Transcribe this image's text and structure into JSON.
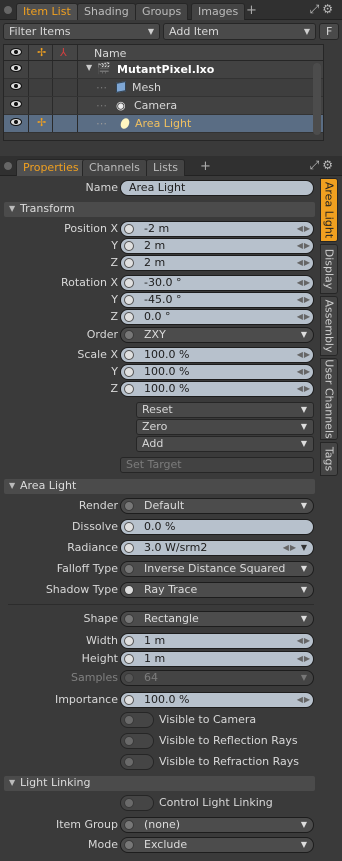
{
  "top_tabs": [
    {
      "label": "Item List",
      "active": true
    },
    {
      "label": "Shading",
      "active": false
    },
    {
      "label": "Groups",
      "active": false
    },
    {
      "label": "Images",
      "active": false
    }
  ],
  "tab_plus": "+",
  "filter_items": "Filter Items",
  "add_item": "Add Item",
  "f_button": "F",
  "tree": {
    "header_name": "Name",
    "rows": [
      {
        "label": "MutantPixel.lxo",
        "icon": "film-scene-icon"
      },
      {
        "label": "Mesh",
        "icon": "mesh-cube-icon"
      },
      {
        "label": "Camera",
        "icon": "camera-icon"
      },
      {
        "label": "Area Light",
        "icon": "area-light-icon",
        "selected": true
      }
    ]
  },
  "bottom_tabs": [
    {
      "label": "Properties",
      "active": true
    },
    {
      "label": "Channels",
      "active": false
    },
    {
      "label": "Lists",
      "active": false
    }
  ],
  "side_tabs": [
    "Area Light",
    "Display",
    "Assembly",
    "User Channels",
    "Tags"
  ],
  "name_label": "Name",
  "name_value": "Area Light",
  "transform": {
    "title": "Transform",
    "position_label": "Position X",
    "position": [
      "-2 m",
      "2 m",
      "2 m"
    ],
    "rotation_label": "Rotation X",
    "rotation": [
      "-30.0 °",
      "-45.0 °",
      "0.0 °"
    ],
    "order_label": "Order",
    "order": "ZXY",
    "scale_label": "Scale X",
    "scale": [
      "100.0 %",
      "100.0 %",
      "100.0 %"
    ],
    "y_label": "Y",
    "z_label": "Z",
    "reset": "Reset",
    "zero": "Zero",
    "add": "Add",
    "set_target": "Set Target"
  },
  "area_light": {
    "title": "Area Light",
    "render_label": "Render",
    "render": "Default",
    "dissolve_label": "Dissolve",
    "dissolve": "0.0 %",
    "radiance_label": "Radiance",
    "radiance": "3.0 W/srm2",
    "falloff_label": "Falloff Type",
    "falloff": "Inverse Distance Squared",
    "shadow_label": "Shadow Type",
    "shadow": "Ray Trace",
    "shape_label": "Shape",
    "shape": "Rectangle",
    "width_label": "Width",
    "width": "1 m",
    "height_label": "Height",
    "height": "1 m",
    "samples_label": "Samples",
    "samples": "64",
    "importance_label": "Importance",
    "importance": "100.0 %",
    "visible_camera": "Visible to Camera",
    "visible_reflection": "Visible to Reflection Rays",
    "visible_refraction": "Visible to Refraction Rays"
  },
  "light_linking": {
    "title": "Light Linking",
    "control": "Control Light Linking",
    "item_group_label": "Item Group",
    "item_group": "(none)",
    "mode_label": "Mode",
    "mode": "Exclude"
  },
  "colors": {
    "accent": "#f0a020",
    "selection": "#5a6d84",
    "field": "#b7c1cc"
  }
}
